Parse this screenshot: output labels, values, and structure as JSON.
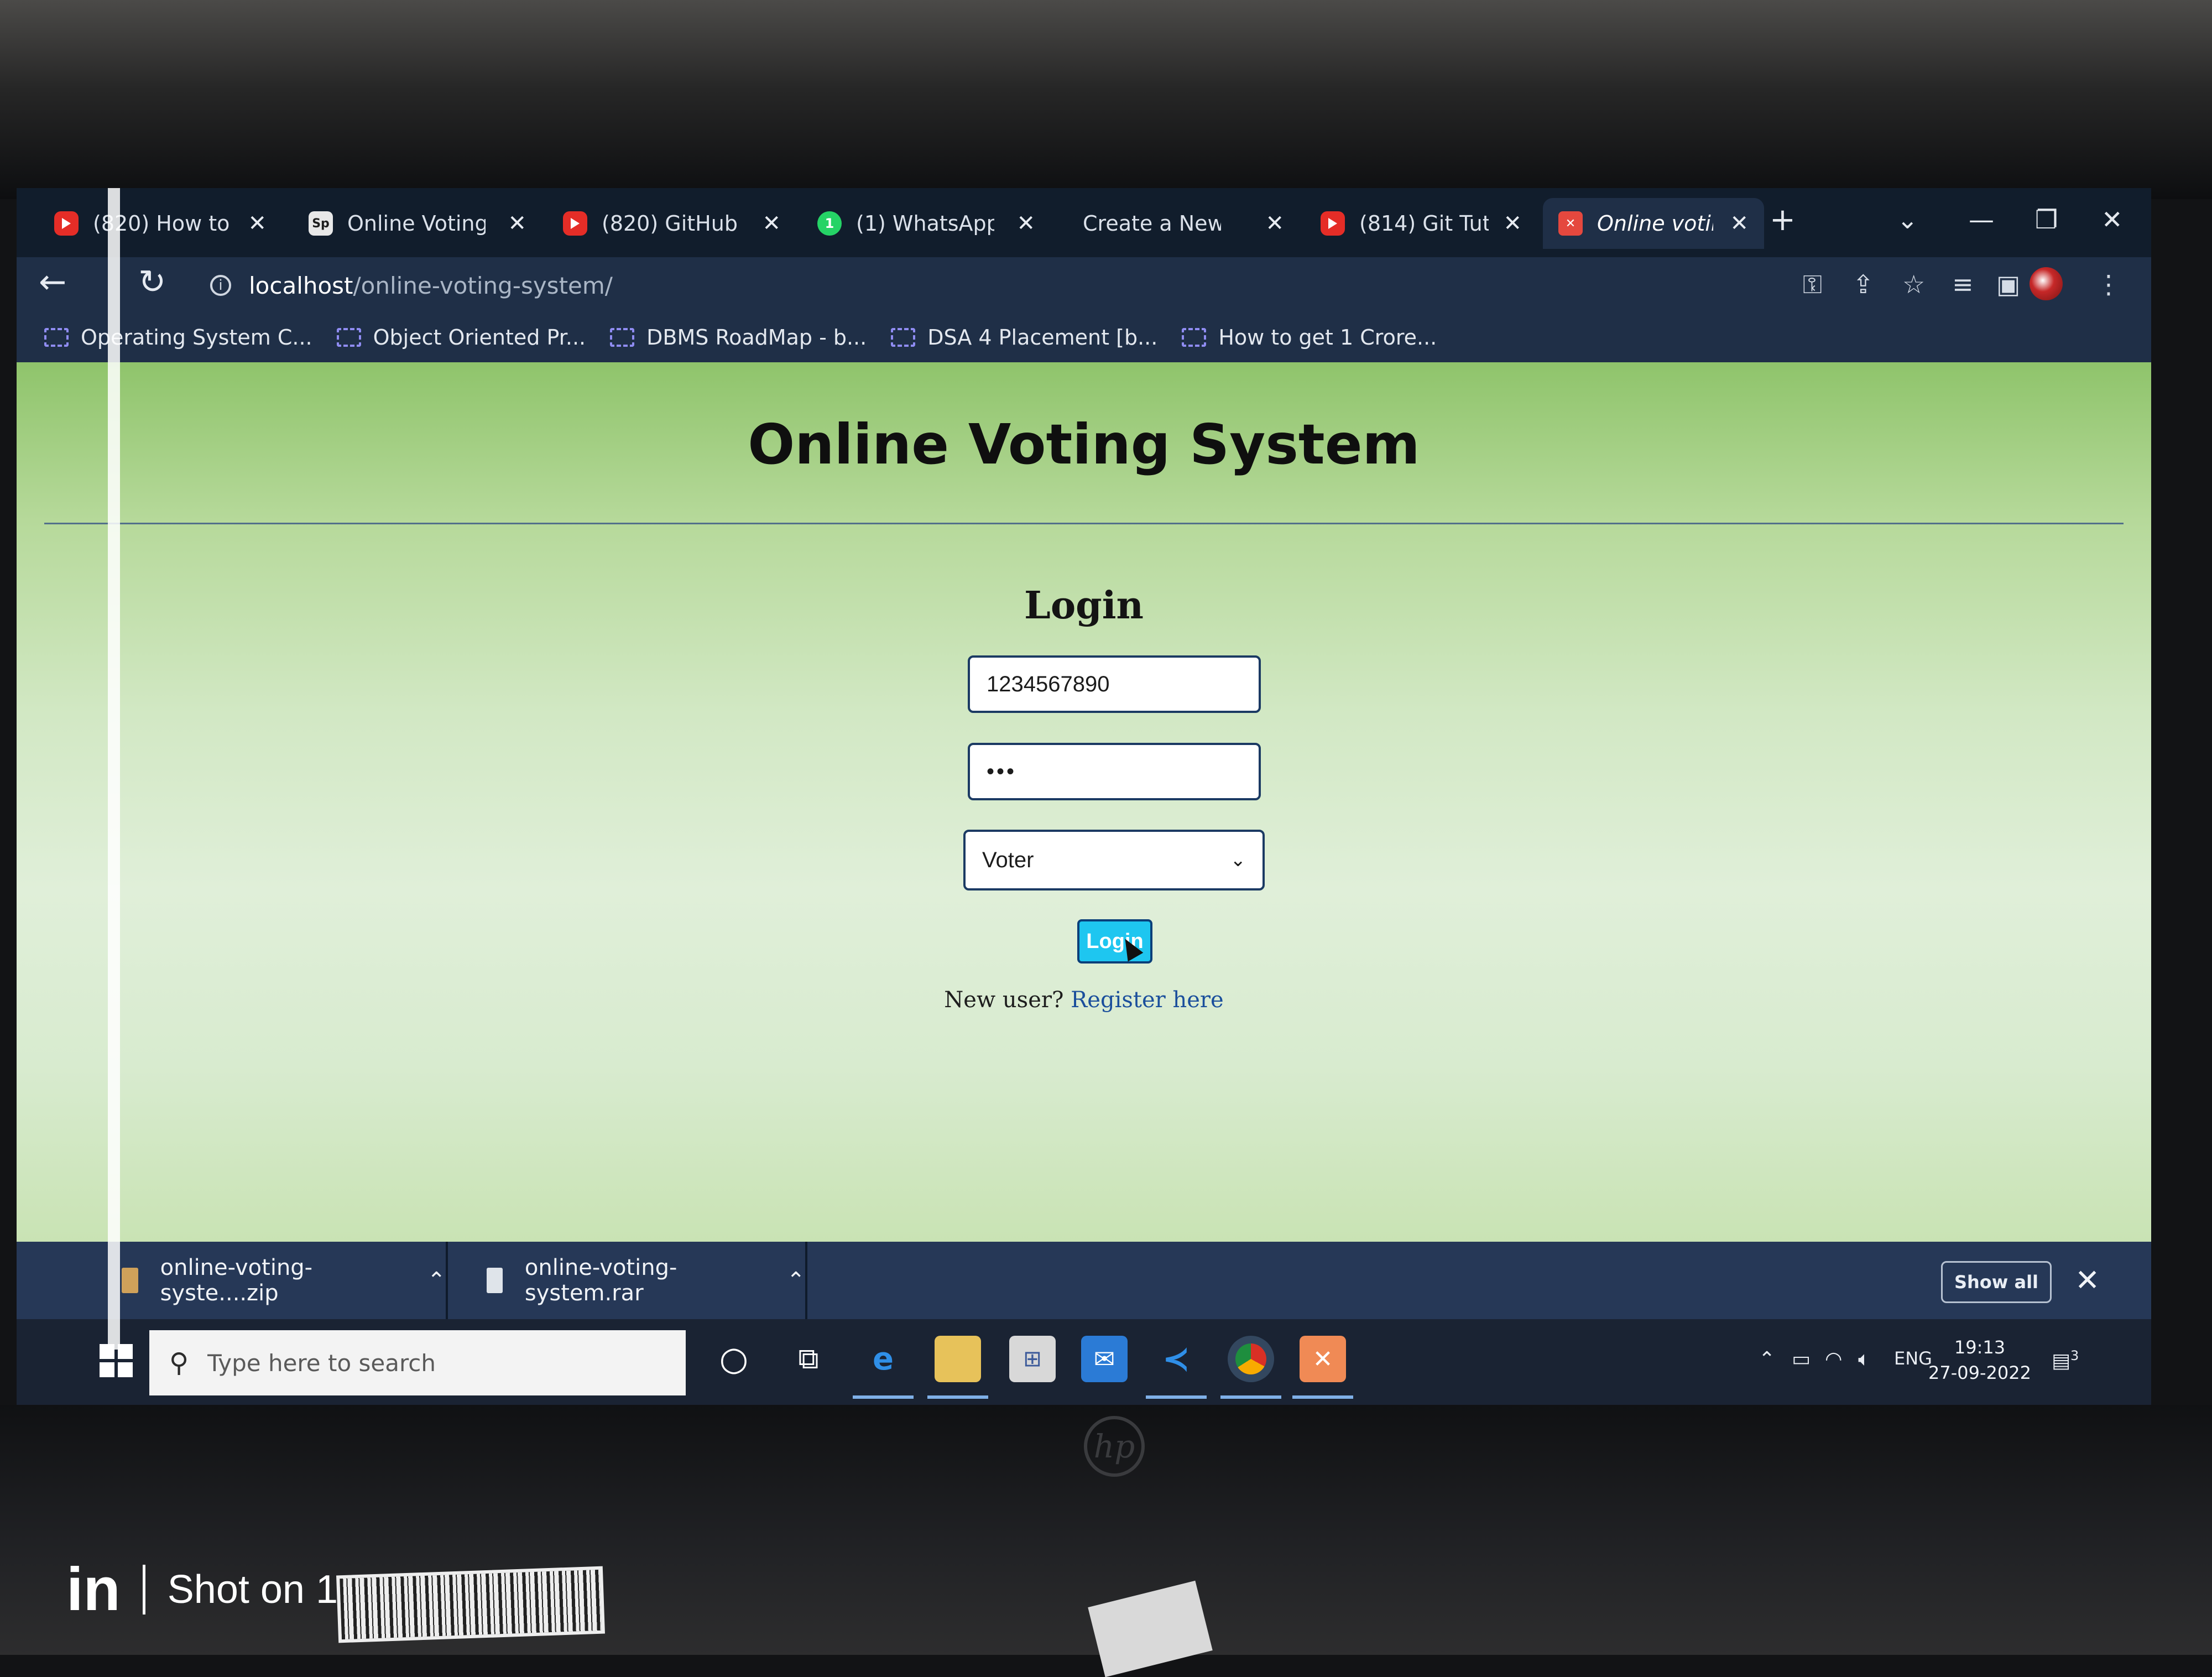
{
  "browser": {
    "tabs": [
      {
        "icon": "youtube-icon",
        "label": "(820) How to D"
      },
      {
        "icon": "sp-icon",
        "label": "Online Voting S"
      },
      {
        "icon": "youtube-icon",
        "label": "(820) GitHub - I"
      },
      {
        "icon": "whatsapp-icon",
        "label": "(1) WhatsApp"
      },
      {
        "icon": "none",
        "label": "Create a New F"
      },
      {
        "icon": "youtube-icon",
        "label": "(814) Git Tutori"
      },
      {
        "icon": "xampp-icon",
        "label": "Online voting sy",
        "active": true
      }
    ],
    "address": {
      "host": "localhost",
      "path": "/online-voting-system/"
    },
    "bookmarks": [
      "Operating System C...",
      "Object Oriented Pr...",
      "DBMS RoadMap - b...",
      "DSA 4 Placement [b...",
      "How to get 1 Crore..."
    ]
  },
  "page": {
    "title": "Online Voting System",
    "login_heading": "Login",
    "mobile_value": "1234567890",
    "password_masked": "•••",
    "role_selected": "Voter",
    "login_button": "Login",
    "register_prompt": "New user?",
    "register_link": "Register here"
  },
  "downloads": {
    "items": [
      "online-voting-syste....zip",
      "online-voting-system.rar"
    ],
    "show_all": "Show all"
  },
  "taskbar": {
    "search_placeholder": "Type here to search",
    "language": "ENG",
    "time": "19:13",
    "date": "27-09-2022",
    "notifications": "3"
  },
  "photo": {
    "watermark_brand": "in",
    "watermark_text": "Shot on 1"
  },
  "colors": {
    "page_gradient_top": "#8fc46b",
    "page_gradient_mid": "#e0efd9",
    "login_button_bg": "#1ec6f0",
    "register_link": "#1b4f9c",
    "browser_toolbar": "#1f2f47"
  }
}
